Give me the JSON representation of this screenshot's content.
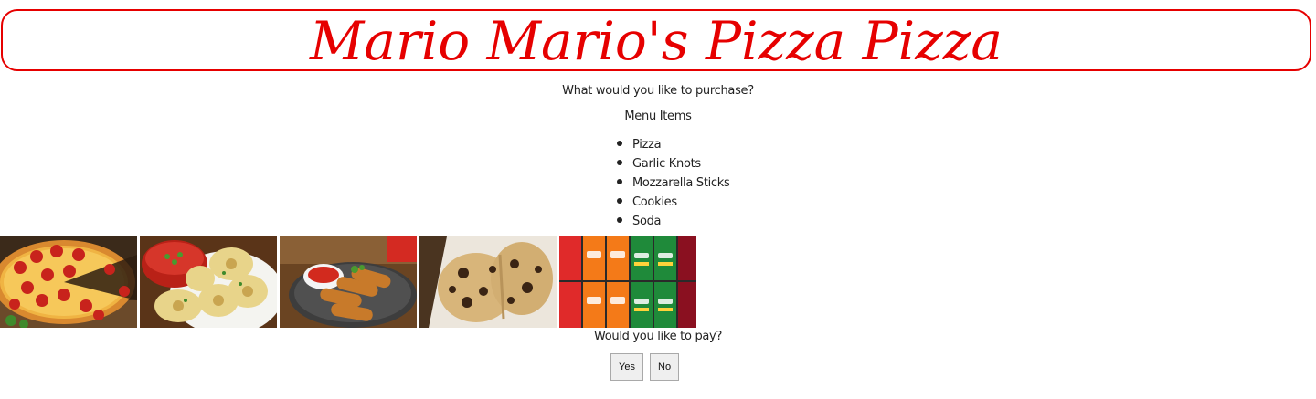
{
  "header": {
    "title": "Mario Mario's Pizza Pizza"
  },
  "prompt": "What would you like to purchase?",
  "menu": {
    "heading": "Menu Items",
    "items": [
      "Pizza",
      "Garlic Knots",
      "Mozzarella Sticks",
      "Cookies",
      "Soda"
    ]
  },
  "gallery": {
    "images": [
      "pizza-photo",
      "garlic-knots-photo",
      "mozzarella-sticks-photo",
      "cookies-photo",
      "soda-photo"
    ]
  },
  "payment": {
    "question": "Would you like to pay?",
    "yes_label": "Yes",
    "no_label": "No"
  },
  "colors": {
    "accent": "#e60000",
    "text": "#222222"
  }
}
